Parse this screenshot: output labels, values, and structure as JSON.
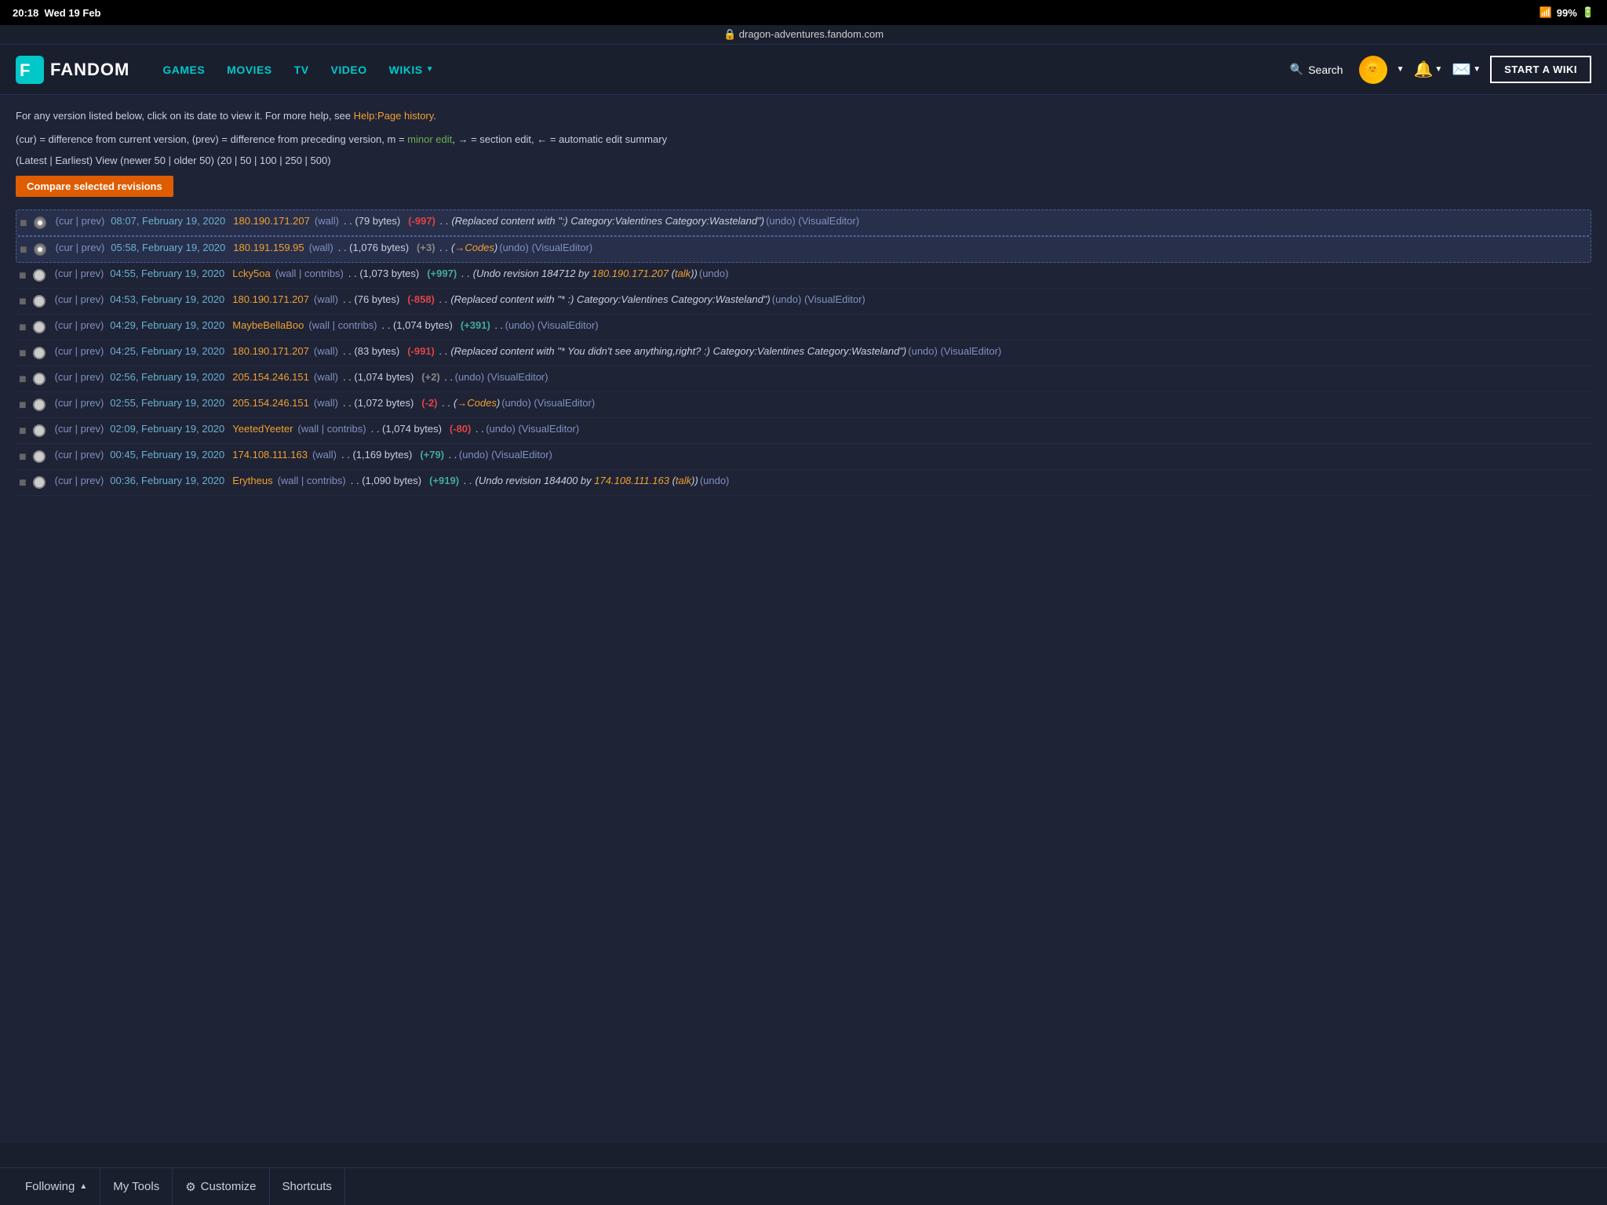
{
  "status_bar": {
    "time": "20:18",
    "date": "Wed 19 Feb",
    "wifi": "99%",
    "battery": "▓▓▓▓"
  },
  "url_bar": {
    "domain": "dragon-adventures.fandom.com",
    "lock_icon": "🔒"
  },
  "nav": {
    "logo_text": "FANDOM",
    "links": [
      {
        "label": "GAMES"
      },
      {
        "label": "MOVIES"
      },
      {
        "label": "TV"
      },
      {
        "label": "VIDEO"
      },
      {
        "label": "WIKIS",
        "has_dropdown": true
      }
    ],
    "search_label": "Search",
    "start_wiki_label": "START A WIKI"
  },
  "page": {
    "info_line1": "For any version listed below, click on its date to view it. For more help, see ",
    "help_link": "Help:Page history",
    "info_line1_end": ".",
    "info_line2_parts": [
      "(cur) = difference from current version, (prev) = difference from preceding version, m = ",
      "minor edit",
      ", → = section edit, ← = automatic edit summary"
    ],
    "nav_hist": "(Latest | Earliest) View (newer 50 | older 50) (20 | 50 | 100 | 250 | 500)",
    "compare_btn_label": "Compare selected revisions"
  },
  "revisions": [
    {
      "id": 1,
      "selected": true,
      "radio_checked": true,
      "links": "(cur | prev)",
      "date": "08:07, February 19, 2020",
      "user": "180.190.171.207",
      "user_type": "wall",
      "bytes": "(79 bytes)",
      "delta": "(-997)",
      "delta_type": "negative",
      "comment": "(Replaced content with \"<blockquote>:)</blockquote> Category:Valentines Category:Wasteland\")",
      "actions": "(undo) (VisualEditor)"
    },
    {
      "id": 2,
      "selected": true,
      "radio_checked": true,
      "links": "(cur | prev)",
      "date": "05:58, February 19, 2020",
      "user": "180.191.159.95",
      "user_type": "wall",
      "bytes": "(1,076 bytes)",
      "delta": "(+3)",
      "delta_type": "small",
      "comment": "(→Codes)",
      "actions": "(undo) (VisualEditor)"
    },
    {
      "id": 3,
      "selected": false,
      "radio_checked": false,
      "links": "(cur | prev)",
      "date": "04:55, February 19, 2020",
      "user": "Lcky5oa",
      "user_type": "wall | contribs",
      "bytes": "(1,073 bytes)",
      "delta": "(+997)",
      "delta_type": "positive",
      "comment": "(Undo revision 184712 by 180.190.171.207 (talk))",
      "actions": "(undo)"
    },
    {
      "id": 4,
      "selected": false,
      "radio_checked": false,
      "links": "(cur | prev)",
      "date": "04:53, February 19, 2020",
      "user": "180.190.171.207",
      "user_type": "wall",
      "bytes": "(76 bytes)",
      "delta": "(-858)",
      "delta_type": "negative",
      "comment": "(Replaced content with \"* <blockquote>:)</blockquote> Category:Valentines Category:Wasteland\")",
      "actions": "(undo) (VisualEditor)"
    },
    {
      "id": 5,
      "selected": false,
      "radio_checked": false,
      "links": "(cur | prev)",
      "date": "04:29, February 19, 2020",
      "user": "MaybeBellaBoo",
      "user_type": "wall | contribs",
      "bytes": "(1,074 bytes)",
      "delta": "(+391)",
      "delta_type": "positive",
      "comment": "",
      "actions": "(undo) (VisualEditor)"
    },
    {
      "id": 6,
      "selected": false,
      "radio_checked": false,
      "links": "(cur | prev)",
      "date": "04:25, February 19, 2020",
      "user": "180.190.171.207",
      "user_type": "wall",
      "bytes": "(83 bytes)",
      "delta": "(-991)",
      "delta_type": "negative",
      "comment": "(Replaced content with \"* You didn't see anything,right? :) Category:Valentines Category:Wasteland\")",
      "actions": "(undo) (VisualEditor)"
    },
    {
      "id": 7,
      "selected": false,
      "radio_checked": false,
      "links": "(cur | prev)",
      "date": "02:56, February 19, 2020",
      "user": "205.154.246.151",
      "user_type": "wall",
      "bytes": "(1,074 bytes)",
      "delta": "(+2)",
      "delta_type": "small",
      "comment": "",
      "actions": "(undo) (VisualEditor)"
    },
    {
      "id": 8,
      "selected": false,
      "radio_checked": false,
      "links": "(cur | prev)",
      "date": "02:55, February 19, 2020",
      "user": "205.154.246.151",
      "user_type": "wall",
      "bytes": "(1,072 bytes)",
      "delta": "(-2)",
      "delta_type": "negative",
      "comment": "(→Codes)",
      "actions": "(undo) (VisualEditor)"
    },
    {
      "id": 9,
      "selected": false,
      "radio_checked": false,
      "links": "(cur | prev)",
      "date": "02:09, February 19, 2020",
      "user": "YeetedYeeter",
      "user_type": "wall | contribs",
      "bytes": "(1,074 bytes)",
      "delta": "(-80)",
      "delta_type": "negative",
      "comment": "",
      "actions": "(undo) (VisualEditor)"
    },
    {
      "id": 10,
      "selected": false,
      "radio_checked": false,
      "links": "(cur | prev)",
      "date": "00:45, February 19, 2020",
      "user": "174.108.111.163",
      "user_type": "wall",
      "bytes": "(1,169 bytes)",
      "delta": "(+79)",
      "delta_type": "positive",
      "comment": "",
      "actions": "(undo) (VisualEditor)"
    },
    {
      "id": 11,
      "selected": false,
      "radio_checked": false,
      "links": "(cur | prev)",
      "date": "00:36, February 19, 2020",
      "user": "Erytheus",
      "user_type": "wall | contribs",
      "bytes": "(1,090 bytes)",
      "delta": "(+919)",
      "delta_type": "positive",
      "comment": "(Undo revision 184400 by 174.108.111.163 (talk))",
      "actions": "(undo)"
    }
  ],
  "bottom_toolbar": {
    "following_label": "Following",
    "my_tools_label": "My Tools",
    "customize_label": "Customize",
    "shortcuts_label": "Shortcuts"
  },
  "colors": {
    "accent": "#f0a030",
    "link_blue": "#6ab0d0",
    "minor_edit": "#6ab04c",
    "positive": "#44aa77",
    "negative": "#dd4444",
    "nav_cyan": "#00c8c8"
  }
}
